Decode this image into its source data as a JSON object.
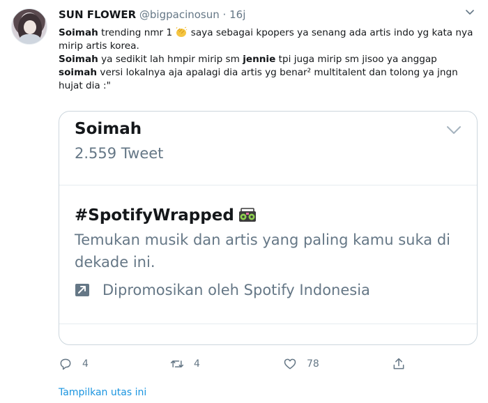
{
  "tweet": {
    "author_name": "SUN FLOWER",
    "author_handle": "@bigpacinosun",
    "separator": "·",
    "time": "16j",
    "line1_a": "Soimah",
    "line1_b": " trending nmr 1 ",
    "line1_c": " saya sebagai kpopers ya senang ada artis indo yg kata nya mirip artis korea.",
    "line2_a": "Soimah",
    "line2_b": " ya sedikit lah hmpir mirip sm ",
    "line2_c": "jennie",
    "line2_d": " tpi juga mirip sm jisoo ya anggap ",
    "line2_e": "soimah",
    "line2_f": " versi lokalnya aja apalagi dia artis yg benar² multitalent dan tolong ya jngn hujat dia :\""
  },
  "card": {
    "trend_title": "Soimah",
    "trend_count": "2.559 Tweet",
    "promo_title": "#SpotifyWrapped",
    "promo_desc": "Temukan musik dan artis yang paling kamu suka di dekade ini.",
    "promo_by": "Dipromosikan oleh Spotify Indonesia"
  },
  "actions": {
    "reply_count": "4",
    "retweet_count": "4",
    "like_count": "78"
  },
  "show_thread": "Tampilkan utas ini",
  "icons": {
    "reply": "reply-icon",
    "retweet": "retweet-icon",
    "like": "like-icon",
    "share": "share-icon",
    "promoted": "promoted-arrow-icon",
    "chevron": "chevron-down-icon"
  },
  "colors": {
    "text": "#14171a",
    "secondary": "#657786",
    "link": "#1b95e0",
    "border": "#ccd6dd"
  }
}
